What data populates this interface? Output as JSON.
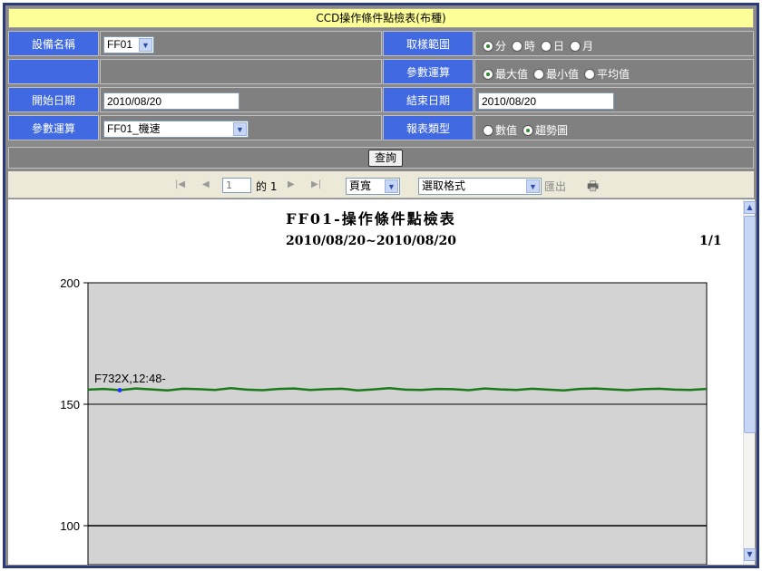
{
  "title": "CCD操作條件點檢表(布種)",
  "form": {
    "equip_label": "設備名稱",
    "equip_value": "FF01",
    "range_label": "取樣範圍",
    "range_options": [
      "分",
      "時",
      "日",
      "月"
    ],
    "range_selected": 0,
    "param_calc_label": "參數運算",
    "calc_options": [
      "最大值",
      "最小值",
      "平均值"
    ],
    "calc_selected": 0,
    "start_label": "開始日期",
    "start_value": "2010/08/20",
    "end_label": "結束日期",
    "end_value": "2010/08/20",
    "param_label": "參數運算",
    "param_value": "FF01_機速",
    "report_type_label": "報表類型",
    "report_type_options": [
      "數值",
      "趨勢圖"
    ],
    "report_type_selected": 1,
    "query_button": "查詢"
  },
  "toolbar": {
    "page_value": "1",
    "page_of": "的 1",
    "zoom_value": "頁寬",
    "format_value": "選取格式",
    "export_label": "匯出"
  },
  "report": {
    "title": "FF01-操作條件點檢表",
    "date_range": "2010/08/20~2010/08/20",
    "page_indicator": "1/1"
  },
  "colors": {
    "label_bg": "#4169e1",
    "title_bg": "#ffff99",
    "series": "#1a7a1a",
    "plot_bg": "#d3d3d3"
  },
  "chart_data": {
    "type": "line",
    "ylim": [
      80,
      200
    ],
    "yticks": [
      100,
      150,
      200
    ],
    "series": [
      {
        "values": [
          156,
          156.3,
          155.8,
          156.5,
          156.1,
          155.7,
          156.4,
          156.2,
          155.9,
          156.6,
          156.0,
          155.8,
          156.3,
          156.5,
          155.9,
          156.2,
          156.4,
          155.7,
          156.1,
          156.6,
          156.0,
          155.9,
          156.3,
          156.2,
          155.8,
          156.5,
          156.1,
          155.9,
          156.4,
          156.0,
          155.7,
          156.3,
          156.5,
          156.1,
          155.8,
          156.2,
          156.4,
          156.0,
          155.9,
          156.3
        ]
      }
    ],
    "annotation": "F732X,12:48-"
  }
}
